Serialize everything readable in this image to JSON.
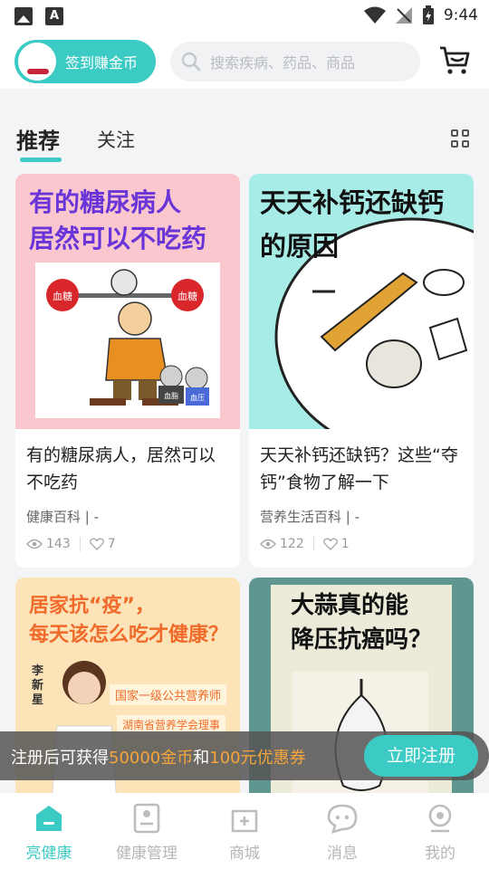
{
  "status_bar": {
    "time": "9:44"
  },
  "header": {
    "checkin_label": "签到赚金币",
    "search_placeholder": "搜索疾病、药品、商品"
  },
  "tabs": {
    "recommend": "推荐",
    "follow": "关注"
  },
  "cards": [
    {
      "cover_title_lines": [
        "有的糖尿病人",
        "居然可以不吃药"
      ],
      "cover_labels": [
        "血糖",
        "血糖",
        "血脂",
        "血压"
      ],
      "title": "有的糖尿病人，居然可以不吃药",
      "meta": "健康百科 | -",
      "views": "143",
      "likes": "7"
    },
    {
      "cover_title_lines": [
        "天天补钙还缺钙",
        "的原因"
      ],
      "title": "天天补钙还缺钙？这些“夺钙”食物了解一下",
      "meta": "营养生活百科 | -",
      "views": "122",
      "likes": "1"
    },
    {
      "cover_title_lines": [
        "居家抗“疫”，",
        "每天该怎么吃才健康？"
      ],
      "cover_name": "李新星",
      "cover_badges": [
        "国家一级公共营养师",
        "湖南省营养学会理事"
      ]
    },
    {
      "cover_title_lines": [
        "大蒜真的能",
        "降压抗癌吗？"
      ]
    }
  ],
  "register_banner": {
    "text_prefix": "注册后可获得",
    "gold_amount": "50000金币",
    "text_and": "和",
    "coupon": "100元优惠券",
    "button_label": "立即注册"
  },
  "bottom_nav": [
    {
      "label": "亮健康",
      "active": true
    },
    {
      "label": "健康管理",
      "active": false
    },
    {
      "label": "商城",
      "active": false
    },
    {
      "label": "消息",
      "active": false
    },
    {
      "label": "我的",
      "active": false
    }
  ],
  "colors": {
    "accent": "#3ccbc4",
    "highlight": "#f5a53a"
  }
}
